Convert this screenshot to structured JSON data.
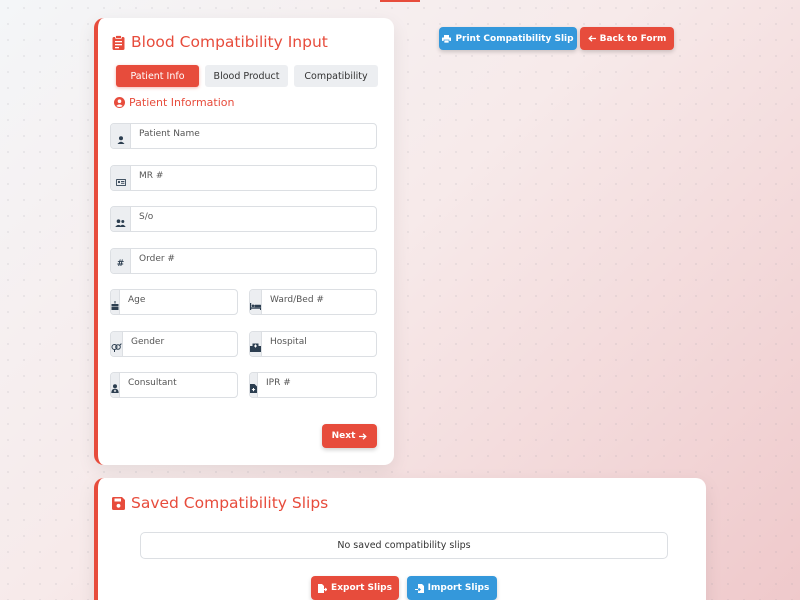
{
  "form_card": {
    "title": "Blood Compatibility Input",
    "tabs": [
      {
        "label": "Patient Info",
        "active": true
      },
      {
        "label": "Blood Product",
        "active": false
      },
      {
        "label": "Compatibility",
        "active": false
      }
    ],
    "section_heading": "Patient Information",
    "fields": {
      "patient_name": {
        "placeholder": "Patient Name",
        "icon": "user-icon"
      },
      "mr": {
        "placeholder": "MR #",
        "icon": "id-card-icon"
      },
      "so": {
        "placeholder": "S/o",
        "icon": "users-icon"
      },
      "order": {
        "placeholder": "Order #",
        "icon": "hashtag-icon"
      },
      "age": {
        "placeholder": "Age",
        "icon": "birthday-cake-icon"
      },
      "ward_bed": {
        "placeholder": "Ward/Bed #",
        "icon": "bed-icon"
      },
      "gender": {
        "placeholder": "Gender",
        "icon": "venus-mars-icon"
      },
      "hospital": {
        "placeholder": "Hospital",
        "icon": "hospital-icon"
      },
      "consultant": {
        "placeholder": "Consultant",
        "icon": "user-doctor-icon"
      },
      "ipr": {
        "placeholder": "IPR #",
        "icon": "file-medical-icon"
      }
    },
    "next_label": "Next"
  },
  "top_actions": {
    "print_label": "Print Compatibility Slip",
    "back_label": "Back to Form"
  },
  "saved_card": {
    "title": "Saved Compatibility Slips",
    "empty_text": "No saved compatibility slips",
    "export_label": "Export Slips",
    "import_label": "Import Slips"
  },
  "colors": {
    "primary": "#e74c3c",
    "secondary": "#3498db",
    "addon_bg": "#eceef1",
    "tab_bg": "#eceef1"
  }
}
